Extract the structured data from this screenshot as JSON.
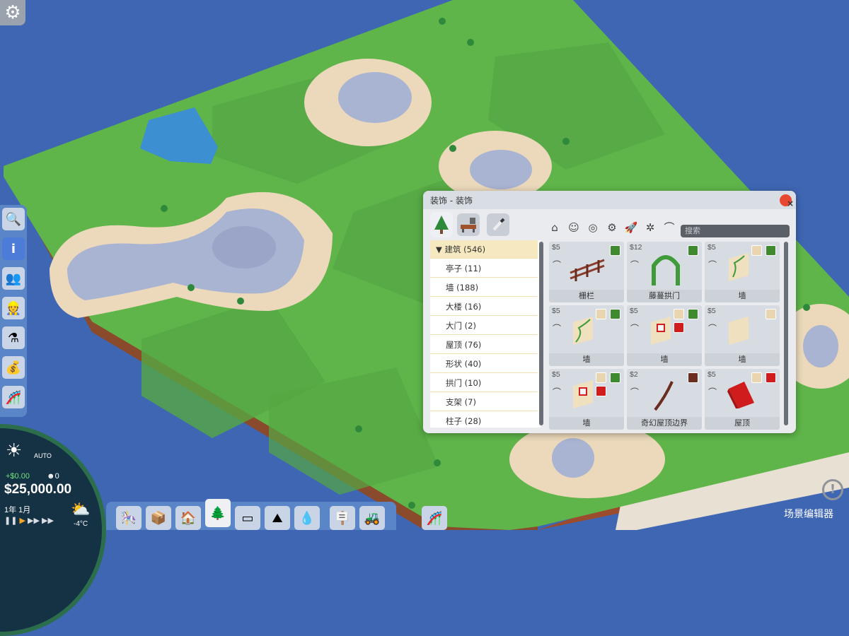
{
  "window": {
    "title": "装饰 - 装饰",
    "close": "×",
    "search_placeholder": "搜索",
    "tabs": [
      {
        "icon": "tree-icon"
      },
      {
        "icon": "bench-icon"
      },
      {
        "icon": "eyedropper-icon"
      }
    ],
    "filters": [
      {
        "icon": "house-icon",
        "glyph": "⌂"
      },
      {
        "icon": "face-icon",
        "glyph": "☺"
      },
      {
        "icon": "target-icon",
        "glyph": "◎"
      },
      {
        "icon": "gears-icon",
        "glyph": "⚙"
      },
      {
        "icon": "rocket-icon",
        "glyph": "🚀"
      },
      {
        "icon": "star-gear-icon",
        "glyph": "✲"
      },
      {
        "icon": "mushroom-icon",
        "glyph": "⌒"
      }
    ],
    "categories": [
      {
        "label": "▼ 建筑 (546)",
        "selected": true
      },
      {
        "label": "亭子 (11)"
      },
      {
        "label": "墙 (188)"
      },
      {
        "label": "大楼 (16)"
      },
      {
        "label": "大门 (2)"
      },
      {
        "label": "屋顶 (76)"
      },
      {
        "label": "形状 (40)"
      },
      {
        "label": "拱门 (10)"
      },
      {
        "label": "支架 (7)"
      },
      {
        "label": "柱子 (28)"
      }
    ],
    "items": [
      {
        "price": "$5",
        "name": "栅栏",
        "swatches": [
          "#3f8a2f"
        ]
      },
      {
        "price": "$12",
        "name": "藤蔓拱门",
        "swatches": [
          "#3f8a2f"
        ]
      },
      {
        "price": "$5",
        "name": "墙",
        "swatches": [
          "#e9d5b0",
          "#3f8a2f"
        ]
      },
      {
        "price": "$5",
        "name": "墙",
        "swatches": [
          "#e9d5b0",
          "#3f8a2f"
        ]
      },
      {
        "price": "$5",
        "name": "墙",
        "swatches": [
          "#e9d5b0",
          "#3f8a2f",
          "#d01c1c"
        ]
      },
      {
        "price": "$5",
        "name": "墙",
        "swatches": [
          "#e9d5b0"
        ]
      },
      {
        "price": "$5",
        "name": "墙",
        "swatches": [
          "#e9d5b0",
          "#3f8a2f",
          "#d01c1c"
        ]
      },
      {
        "price": "$2",
        "name": "奇幻屋顶边界",
        "swatches": [
          "#6b2d1f"
        ]
      },
      {
        "price": "$5",
        "name": "屋顶",
        "swatches": [
          "#e9d5b0",
          "#d01c1c"
        ]
      }
    ]
  },
  "status": {
    "weather_mode": "AUTO",
    "income": "+$0.00",
    "guests": "0",
    "money": "$25,000.00",
    "date": "1年 1月",
    "temperature": "-4°C"
  },
  "hud": {
    "scene_editor": "场景编辑器",
    "info": "!"
  },
  "colors": {
    "water_bg": "#3f66b3",
    "grass": "#5fb54a",
    "sand": "#ecd9bb",
    "lake": "#a9b3d2",
    "accent_red": "#e8482f"
  }
}
